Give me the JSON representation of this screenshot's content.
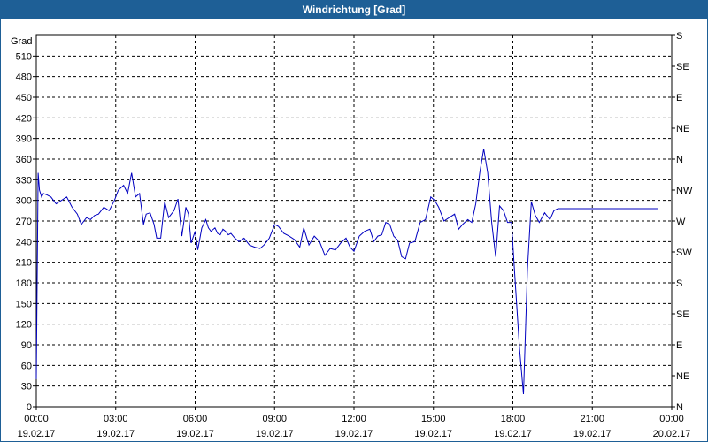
{
  "window": {
    "title": "Windrichtung [Grad]"
  },
  "chart_data": {
    "type": "line",
    "title": "Windrichtung [Grad]",
    "ylabel": "Grad",
    "ylim": [
      0,
      540
    ],
    "y_ticks": [
      0,
      30,
      60,
      90,
      120,
      150,
      180,
      210,
      240,
      270,
      300,
      330,
      360,
      390,
      420,
      450,
      480,
      510
    ],
    "y2_ticks": [
      "N",
      "NE",
      "E",
      "SE",
      "S",
      "SW",
      "W",
      "NW",
      "N",
      "NE",
      "E",
      "SE",
      "S"
    ],
    "x_ticks": [
      {
        "time": "00:00",
        "date": "19.02.17"
      },
      {
        "time": "03:00",
        "date": "19.02.17"
      },
      {
        "time": "06:00",
        "date": "19.02.17"
      },
      {
        "time": "09:00",
        "date": "19.02.17"
      },
      {
        "time": "12:00",
        "date": "19.02.17"
      },
      {
        "time": "15:00",
        "date": "19.02.17"
      },
      {
        "time": "18:00",
        "date": "19.02.17"
      },
      {
        "time": "21:00",
        "date": "19.02.17"
      },
      {
        "time": "00:00",
        "date": "20.02.17"
      }
    ],
    "grid": true,
    "series": [
      {
        "color": "#0000c0",
        "x_hours": [
          0.0,
          0.07,
          0.12,
          0.2,
          0.27,
          0.4,
          0.55,
          0.75,
          0.95,
          1.15,
          1.35,
          1.55,
          1.7,
          1.9,
          2.05,
          2.2,
          2.35,
          2.55,
          2.75,
          2.95,
          3.1,
          3.3,
          3.45,
          3.6,
          3.75,
          3.9,
          4.05,
          4.15,
          4.3,
          4.45,
          4.55,
          4.7,
          4.85,
          5.0,
          5.2,
          5.35,
          5.5,
          5.65,
          5.75,
          5.85,
          6.0,
          6.1,
          6.25,
          6.4,
          6.5,
          6.6,
          6.75,
          6.85,
          6.95,
          7.05,
          7.15,
          7.25,
          7.35,
          7.5,
          7.65,
          7.85,
          8.05,
          8.25,
          8.45,
          8.6,
          8.8,
          9.0,
          9.15,
          9.35,
          9.55,
          9.75,
          9.95,
          10.1,
          10.3,
          10.5,
          10.7,
          10.9,
          11.1,
          11.3,
          11.5,
          11.7,
          11.85,
          12.0,
          12.2,
          12.4,
          12.6,
          12.75,
          12.9,
          13.05,
          13.2,
          13.35,
          13.5,
          13.65,
          13.8,
          13.95,
          14.1,
          14.3,
          14.5,
          14.7,
          14.9,
          15.05,
          15.2,
          15.4,
          15.6,
          15.8,
          15.95,
          16.1,
          16.3,
          16.45,
          16.6,
          16.75,
          16.9,
          17.05,
          17.2,
          17.35,
          17.5,
          17.65,
          17.8,
          17.95,
          18.05,
          18.25,
          18.4,
          18.55,
          18.7,
          18.85,
          19.0,
          19.2,
          19.4,
          19.55,
          19.7,
          19.85,
          20.0,
          20.2,
          20.4,
          20.55,
          20.75,
          20.9,
          20.95,
          21.05,
          21.15,
          21.25,
          21.35,
          21.5,
          21.6,
          21.7,
          21.8,
          21.9,
          22.05,
          22.15,
          22.25,
          22.35,
          22.45,
          22.55,
          22.65,
          22.7,
          22.75,
          22.85,
          22.95,
          23.05,
          23.2,
          23.35,
          23.5,
          23.65,
          23.8
        ],
        "values": [
          40,
          340,
          315,
          305,
          310,
          308,
          305,
          295,
          300,
          305,
          290,
          280,
          265,
          275,
          272,
          278,
          280,
          290,
          285,
          300,
          315,
          322,
          310,
          340,
          305,
          310,
          265,
          280,
          282,
          265,
          245,
          245,
          298,
          275,
          285,
          302,
          248,
          290,
          280,
          238,
          255,
          228,
          260,
          272,
          260,
          255,
          260,
          252,
          250,
          258,
          255,
          250,
          252,
          245,
          240,
          245,
          235,
          232,
          230,
          235,
          245,
          265,
          262,
          252,
          248,
          243,
          232,
          260,
          235,
          248,
          240,
          220,
          230,
          228,
          238,
          245,
          232,
          226,
          248,
          255,
          258,
          240,
          248,
          250,
          268,
          265,
          248,
          242,
          218,
          215,
          238,
          240,
          268,
          272,
          305,
          300,
          290,
          270,
          275,
          280,
          258,
          265,
          272,
          268,
          295,
          340,
          375,
          340,
          268,
          218,
          292,
          285,
          268,
          268,
          205,
          85,
          18,
          200,
          298,
          278,
          268,
          282,
          272,
          285,
          288,
          288,
          288,
          288,
          288,
          288,
          288,
          288,
          288,
          288,
          288,
          288,
          288,
          288,
          288,
          288,
          288,
          288,
          288,
          288,
          288,
          288,
          288,
          288,
          288,
          288,
          288,
          288,
          288,
          288,
          288,
          288,
          288
        ]
      }
    ]
  }
}
